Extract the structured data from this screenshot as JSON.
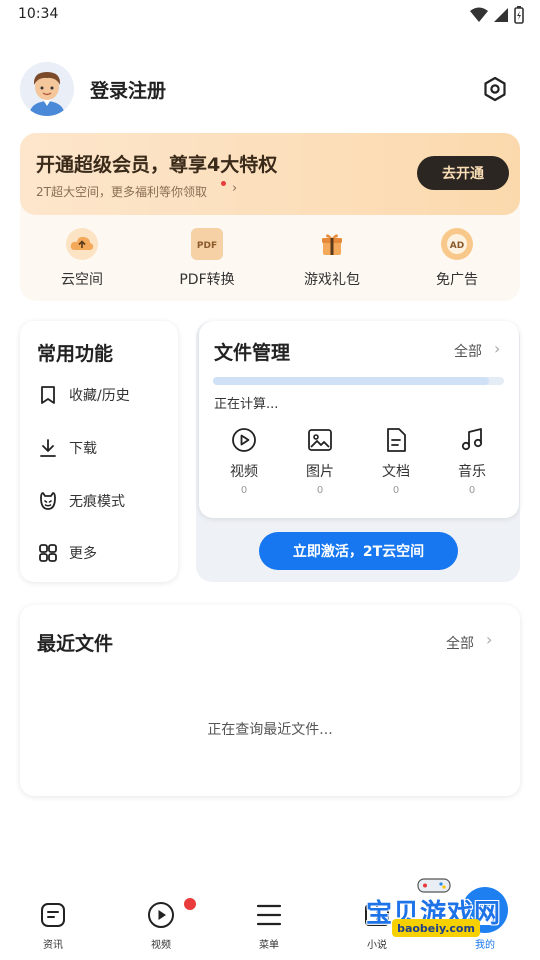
{
  "status_bar": {
    "time": "10:34"
  },
  "profile": {
    "login_label": "登录注册"
  },
  "vip": {
    "title": "开通超级会员，尊享4大特权",
    "subtitle": "2T超大空间，更多福利等你领取",
    "button": "去开通",
    "benefits": [
      {
        "label": "云空间",
        "icon": "cloud-upload-icon"
      },
      {
        "label": "PDF转换",
        "icon": "pdf-icon"
      },
      {
        "label": "游戏礼包",
        "icon": "gift-icon"
      },
      {
        "label": "免广告",
        "icon": "ad-free-icon"
      }
    ]
  },
  "common": {
    "title": "常用功能",
    "items": [
      {
        "label": "收藏/历史",
        "icon": "bookmark-icon"
      },
      {
        "label": "下载",
        "icon": "download-icon"
      },
      {
        "label": "无痕模式",
        "icon": "incognito-icon"
      },
      {
        "label": "更多",
        "icon": "grid-more-icon"
      }
    ]
  },
  "files": {
    "title": "文件管理",
    "all_label": "全部",
    "status": "正在计算...",
    "progress": 0.95,
    "types": [
      {
        "label": "视频",
        "count": "0",
        "icon": "video-icon"
      },
      {
        "label": "图片",
        "count": "0",
        "icon": "image-icon"
      },
      {
        "label": "文档",
        "count": "0",
        "icon": "document-icon"
      },
      {
        "label": "音乐",
        "count": "0",
        "icon": "music-icon"
      }
    ],
    "activate_button": "立即激活，2T云空间"
  },
  "recent": {
    "title": "最近文件",
    "all_label": "全部",
    "status": "正在查询最近文件..."
  },
  "bottom_nav": [
    {
      "label": "资讯",
      "icon": "news-icon"
    },
    {
      "label": "视频",
      "icon": "play-icon",
      "badge": true
    },
    {
      "label": "菜单",
      "icon": "menu-icon"
    },
    {
      "label": "小说",
      "icon": "book-icon"
    },
    {
      "label": "我的",
      "icon": "profile-icon",
      "active": true
    }
  ],
  "watermark": {
    "text": "宝贝游戏网",
    "url": "baobeiy.com"
  },
  "colors": {
    "accent": "#1677f0",
    "vip_gradient_start": "#fde6cc",
    "vip_gradient_end": "#fbd9ad",
    "vip_button": "#2b2622",
    "badge": "#e93b3b"
  }
}
